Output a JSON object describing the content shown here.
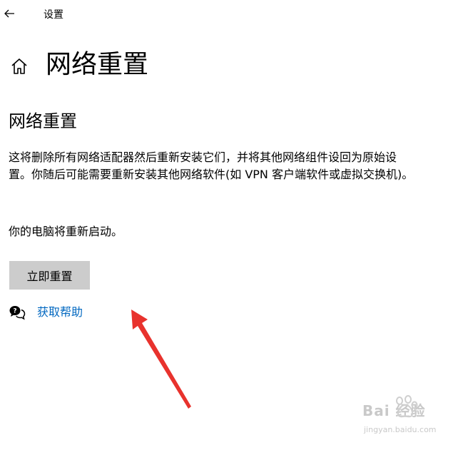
{
  "header": {
    "back_icon": "back-arrow-icon",
    "app_title": "设置"
  },
  "page": {
    "home_icon": "home-icon",
    "title": "网络重置"
  },
  "section": {
    "title": "网络重置",
    "description": "这将删除所有网络适配器然后重新安装它们，并将其他网络组件设回为原始设置。你随后可能需要重新安装其他网络软件(如 VPN 客户端软件或虚拟交换机)。",
    "restart_note": "你的电脑将重新启动。",
    "reset_button_label": "立即重置"
  },
  "help": {
    "icon": "chat-help-icon",
    "link_label": "获取帮助",
    "link_color": "#0067c0"
  },
  "annotation": {
    "arrow_color": "#e8322d"
  },
  "watermark": {
    "brand": "Bai 经验",
    "url": "jingyan.baidu.com"
  }
}
